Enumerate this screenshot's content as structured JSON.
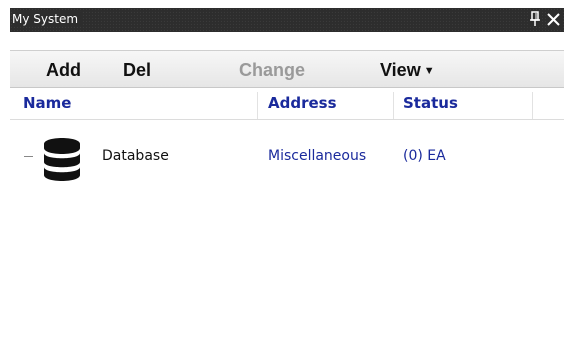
{
  "window": {
    "title": "My System",
    "pin_icon": "pin-icon",
    "close_icon": "close-icon"
  },
  "toolbar": {
    "add_label": "Add",
    "del_label": "Del",
    "change_label": "Change",
    "view_label": "View",
    "view_caret_icon": "caret-down-icon"
  },
  "table": {
    "columns": [
      "Name",
      "Address",
      "Status"
    ],
    "rows": [
      {
        "icon": "database-icon",
        "name": "Database",
        "address": "Miscellaneous",
        "status": "(0) EA"
      }
    ]
  },
  "colors": {
    "titlebar_bg": "#2d2d2d",
    "header_text": "#1a2a9c",
    "link_text": "#1a2a9c",
    "disabled_text": "#9a9a9a"
  }
}
